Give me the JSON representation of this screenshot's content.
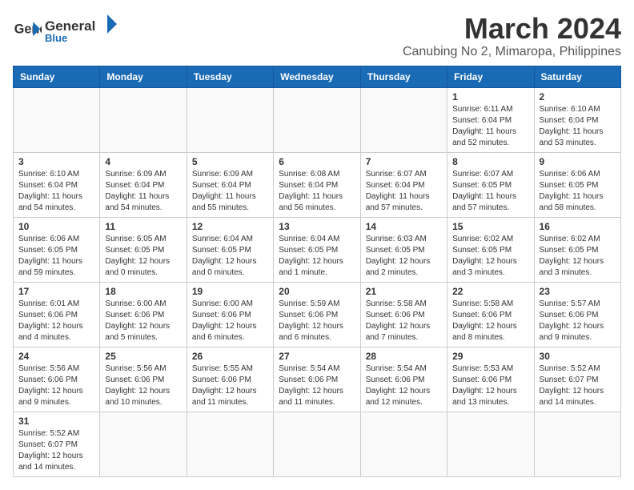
{
  "header": {
    "logo_text_general": "General",
    "logo_text_blue": "Blue",
    "month_title": "March 2024",
    "location": "Canubing No 2, Mimaropa, Philippines"
  },
  "weekdays": [
    "Sunday",
    "Monday",
    "Tuesday",
    "Wednesday",
    "Thursday",
    "Friday",
    "Saturday"
  ],
  "days": {
    "1": {
      "sunrise": "6:11 AM",
      "sunset": "6:04 PM",
      "daylight": "11 hours and 52 minutes."
    },
    "2": {
      "sunrise": "6:10 AM",
      "sunset": "6:04 PM",
      "daylight": "11 hours and 53 minutes."
    },
    "3": {
      "sunrise": "6:10 AM",
      "sunset": "6:04 PM",
      "daylight": "11 hours and 54 minutes."
    },
    "4": {
      "sunrise": "6:09 AM",
      "sunset": "6:04 PM",
      "daylight": "11 hours and 54 minutes."
    },
    "5": {
      "sunrise": "6:09 AM",
      "sunset": "6:04 PM",
      "daylight": "11 hours and 55 minutes."
    },
    "6": {
      "sunrise": "6:08 AM",
      "sunset": "6:04 PM",
      "daylight": "11 hours and 56 minutes."
    },
    "7": {
      "sunrise": "6:07 AM",
      "sunset": "6:04 PM",
      "daylight": "11 hours and 57 minutes."
    },
    "8": {
      "sunrise": "6:07 AM",
      "sunset": "6:05 PM",
      "daylight": "11 hours and 57 minutes."
    },
    "9": {
      "sunrise": "6:06 AM",
      "sunset": "6:05 PM",
      "daylight": "11 hours and 58 minutes."
    },
    "10": {
      "sunrise": "6:06 AM",
      "sunset": "6:05 PM",
      "daylight": "11 hours and 59 minutes."
    },
    "11": {
      "sunrise": "6:05 AM",
      "sunset": "6:05 PM",
      "daylight": "12 hours and 0 minutes."
    },
    "12": {
      "sunrise": "6:04 AM",
      "sunset": "6:05 PM",
      "daylight": "12 hours and 0 minutes."
    },
    "13": {
      "sunrise": "6:04 AM",
      "sunset": "6:05 PM",
      "daylight": "12 hours and 1 minute."
    },
    "14": {
      "sunrise": "6:03 AM",
      "sunset": "6:05 PM",
      "daylight": "12 hours and 2 minutes."
    },
    "15": {
      "sunrise": "6:02 AM",
      "sunset": "6:05 PM",
      "daylight": "12 hours and 3 minutes."
    },
    "16": {
      "sunrise": "6:02 AM",
      "sunset": "6:05 PM",
      "daylight": "12 hours and 3 minutes."
    },
    "17": {
      "sunrise": "6:01 AM",
      "sunset": "6:06 PM",
      "daylight": "12 hours and 4 minutes."
    },
    "18": {
      "sunrise": "6:00 AM",
      "sunset": "6:06 PM",
      "daylight": "12 hours and 5 minutes."
    },
    "19": {
      "sunrise": "6:00 AM",
      "sunset": "6:06 PM",
      "daylight": "12 hours and 6 minutes."
    },
    "20": {
      "sunrise": "5:59 AM",
      "sunset": "6:06 PM",
      "daylight": "12 hours and 6 minutes."
    },
    "21": {
      "sunrise": "5:58 AM",
      "sunset": "6:06 PM",
      "daylight": "12 hours and 7 minutes."
    },
    "22": {
      "sunrise": "5:58 AM",
      "sunset": "6:06 PM",
      "daylight": "12 hours and 8 minutes."
    },
    "23": {
      "sunrise": "5:57 AM",
      "sunset": "6:06 PM",
      "daylight": "12 hours and 9 minutes."
    },
    "24": {
      "sunrise": "5:56 AM",
      "sunset": "6:06 PM",
      "daylight": "12 hours and 9 minutes."
    },
    "25": {
      "sunrise": "5:56 AM",
      "sunset": "6:06 PM",
      "daylight": "12 hours and 10 minutes."
    },
    "26": {
      "sunrise": "5:55 AM",
      "sunset": "6:06 PM",
      "daylight": "12 hours and 11 minutes."
    },
    "27": {
      "sunrise": "5:54 AM",
      "sunset": "6:06 PM",
      "daylight": "12 hours and 11 minutes."
    },
    "28": {
      "sunrise": "5:54 AM",
      "sunset": "6:06 PM",
      "daylight": "12 hours and 12 minutes."
    },
    "29": {
      "sunrise": "5:53 AM",
      "sunset": "6:06 PM",
      "daylight": "12 hours and 13 minutes."
    },
    "30": {
      "sunrise": "5:52 AM",
      "sunset": "6:07 PM",
      "daylight": "12 hours and 14 minutes."
    },
    "31": {
      "sunrise": "5:52 AM",
      "sunset": "6:07 PM",
      "daylight": "12 hours and 14 minutes."
    }
  }
}
